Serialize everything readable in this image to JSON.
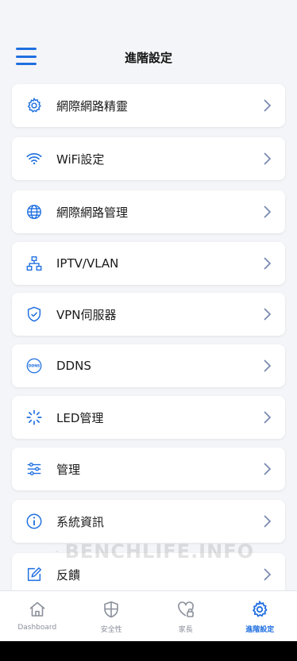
{
  "header": {
    "title": "進階設定",
    "menu_icon": "hamburger-menu-icon"
  },
  "menu_items": [
    {
      "label": "網際網路精靈",
      "icon": "gear-icon"
    },
    {
      "label": "WiFi設定",
      "icon": "wifi-icon"
    },
    {
      "label": "網際網路管理",
      "icon": "globe-icon"
    },
    {
      "label": "IPTV/VLAN",
      "icon": "network-topology-icon"
    },
    {
      "label": "VPN伺服器",
      "icon": "shield-check-icon"
    },
    {
      "label": "DDNS",
      "icon": "ddns-icon"
    },
    {
      "label": "LED管理",
      "icon": "led-icon"
    },
    {
      "label": "管理",
      "icon": "sliders-icon"
    },
    {
      "label": "系統資訊",
      "icon": "info-icon"
    },
    {
      "label": "反饋",
      "icon": "feedback-edit-icon"
    }
  ],
  "ddns_icon_text": "DDNS",
  "watermark": "BENCHLIFE.INFO",
  "bottom_nav": [
    {
      "label": "Dashboard",
      "icon": "home-icon",
      "active": false
    },
    {
      "label": "安全性",
      "icon": "shield-icon",
      "active": false
    },
    {
      "label": "家長",
      "icon": "heart-lock-icon",
      "active": false
    },
    {
      "label": "進階設定",
      "icon": "gear-icon",
      "active": true
    }
  ],
  "colors": {
    "accent": "#1f6fe0",
    "background": "#f4f5f8",
    "chevron": "#7a8bb0"
  }
}
